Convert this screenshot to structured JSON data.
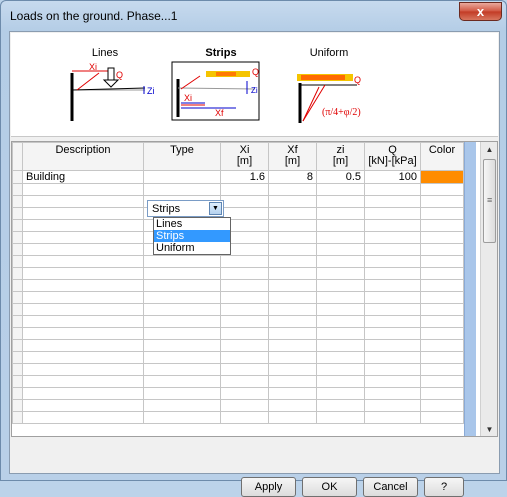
{
  "window": {
    "title": "Loads on the ground. Phase...1",
    "close_glyph": "x"
  },
  "diagrams": [
    {
      "name": "lines",
      "caption": "Lines",
      "labels": [
        "Xi",
        "Q",
        "Zi"
      ]
    },
    {
      "name": "strips",
      "caption": "Strips",
      "labels": [
        "Q",
        "Zi",
        "Xi",
        "Xf"
      ]
    },
    {
      "name": "uniform",
      "caption": "Uniform",
      "labels": [
        "Q",
        "(π/4+φ/2)"
      ]
    }
  ],
  "table": {
    "columns": [
      {
        "key": "description",
        "label": "Description"
      },
      {
        "key": "type",
        "label": "Type"
      },
      {
        "key": "xi",
        "label": "Xi",
        "unit": "[m]"
      },
      {
        "key": "xf",
        "label": "Xf",
        "unit": "[m]"
      },
      {
        "key": "zi",
        "label": "zi",
        "unit": "[m]"
      },
      {
        "key": "q",
        "label": "Q",
        "unit": "[kN]-[kPa]"
      },
      {
        "key": "color",
        "label": "Color"
      }
    ],
    "rows": [
      {
        "description": "Building",
        "type": "Strips",
        "xi": "1.6",
        "xf": "8",
        "zi": "0.5",
        "q": "100",
        "color": "#ff8c00"
      }
    ],
    "empty_rows": 20
  },
  "type_dropdown": {
    "selected": "Strips",
    "options": [
      "Lines",
      "Strips",
      "Uniform"
    ]
  },
  "buttons": {
    "apply": "Apply",
    "ok": "OK",
    "cancel": "Cancel",
    "help": "?"
  },
  "colors": {
    "row_color": "#ff8c00",
    "selection": "#3399ff",
    "diagram_red": "#e00000",
    "diagram_blue": "#0000cc"
  }
}
